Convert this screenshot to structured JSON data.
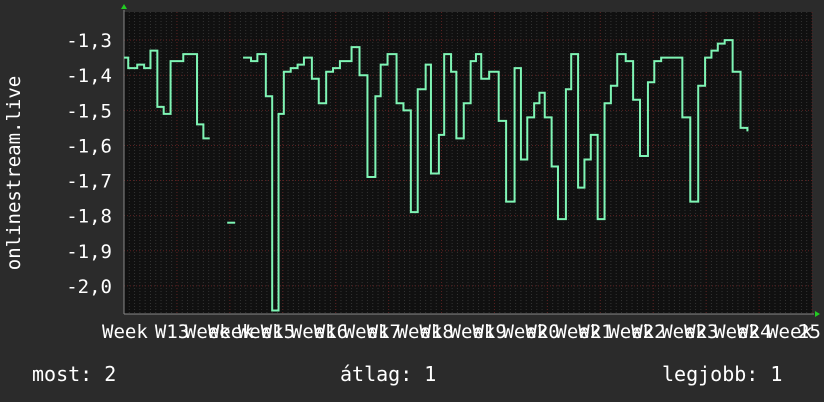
{
  "chart_data": {
    "type": "line",
    "ylabel": "onlinestream.live",
    "xlabel": "",
    "ylim": [
      -2.08,
      -1.22
    ],
    "yticks": [
      -1.3,
      -1.4,
      -1.5,
      -1.6,
      -1.7,
      -1.8,
      -1.9,
      -2.0
    ],
    "ytick_labels": [
      "-1,3",
      "-1,4",
      "-1,5",
      "-1,6",
      "-1,7",
      "-1,8",
      "-1,9",
      "-2,0"
    ],
    "xlim": [
      12,
      25
    ],
    "xticks": [
      12,
      13,
      14,
      15,
      16,
      17,
      18,
      19,
      20,
      21,
      22,
      23,
      24,
      25
    ],
    "xtick_labels": [
      "Week",
      "W13",
      "Week",
      "W15",
      "W16",
      "W17",
      "W18",
      "W19",
      "W20",
      "W21",
      "W22",
      "W23",
      "W24",
      "25"
    ],
    "x_labels_extra": [
      "Week",
      "Week",
      "Week",
      "Week",
      "Week",
      "Week",
      "Week",
      "Week",
      "Week",
      "Week",
      "Week",
      "Week"
    ],
    "grid": true,
    "colors": {
      "line": "#7ff5b5",
      "background": "#101010",
      "grid": "#5a2020",
      "axis": "#888888",
      "arrow": "#22cc22"
    },
    "series": [
      {
        "segments": [
          [
            [
              12.0,
              -1.35
            ],
            [
              12.08,
              -1.38
            ],
            [
              12.25,
              -1.37
            ],
            [
              12.38,
              -1.38
            ],
            [
              12.5,
              -1.33
            ],
            [
              12.63,
              -1.49
            ],
            [
              12.75,
              -1.51
            ],
            [
              12.88,
              -1.36
            ],
            [
              13.12,
              -1.34
            ],
            [
              13.38,
              -1.54
            ],
            [
              13.5,
              -1.58
            ],
            [
              13.62,
              -1.58
            ]
          ],
          [
            [
              13.95,
              -1.82
            ],
            [
              14.1,
              -1.82
            ]
          ],
          [
            [
              14.25,
              -1.35
            ],
            [
              14.4,
              -1.36
            ],
            [
              14.52,
              -1.34
            ],
            [
              14.68,
              -1.46
            ],
            [
              14.8,
              -2.07
            ],
            [
              14.92,
              -1.51
            ],
            [
              15.02,
              -1.39
            ],
            [
              15.15,
              -1.38
            ],
            [
              15.28,
              -1.37
            ],
            [
              15.4,
              -1.35
            ],
            [
              15.55,
              -1.41
            ],
            [
              15.68,
              -1.48
            ],
            [
              15.82,
              -1.39
            ],
            [
              15.95,
              -1.38
            ],
            [
              16.08,
              -1.36
            ],
            [
              16.3,
              -1.32
            ],
            [
              16.45,
              -1.4
            ],
            [
              16.6,
              -1.69
            ],
            [
              16.75,
              -1.46
            ],
            [
              16.85,
              -1.37
            ],
            [
              16.98,
              -1.34
            ],
            [
              17.15,
              -1.48
            ],
            [
              17.28,
              -1.5
            ],
            [
              17.42,
              -1.79
            ],
            [
              17.55,
              -1.44
            ],
            [
              17.7,
              -1.37
            ],
            [
              17.8,
              -1.68
            ],
            [
              17.95,
              -1.57
            ],
            [
              18.05,
              -1.34
            ],
            [
              18.18,
              -1.39
            ],
            [
              18.28,
              -1.58
            ],
            [
              18.42,
              -1.48
            ],
            [
              18.55,
              -1.36
            ],
            [
              18.65,
              -1.34
            ],
            [
              18.75,
              -1.41
            ],
            [
              18.9,
              -1.39
            ],
            [
              19.08,
              -1.53
            ],
            [
              19.22,
              -1.76
            ],
            [
              19.38,
              -1.38
            ],
            [
              19.5,
              -1.64
            ],
            [
              19.62,
              -1.52
            ],
            [
              19.75,
              -1.48
            ],
            [
              19.85,
              -1.45
            ],
            [
              19.95,
              -1.52
            ],
            [
              20.08,
              -1.66
            ],
            [
              20.2,
              -1.81
            ],
            [
              20.35,
              -1.44
            ],
            [
              20.45,
              -1.34
            ],
            [
              20.58,
              -1.72
            ],
            [
              20.7,
              -1.64
            ],
            [
              20.82,
              -1.57
            ],
            [
              20.95,
              -1.81
            ],
            [
              21.08,
              -1.48
            ],
            [
              21.2,
              -1.43
            ],
            [
              21.32,
              -1.34
            ],
            [
              21.48,
              -1.36
            ],
            [
              21.62,
              -1.47
            ],
            [
              21.75,
              -1.63
            ],
            [
              21.9,
              -1.42
            ],
            [
              22.02,
              -1.36
            ],
            [
              22.15,
              -1.35
            ],
            [
              22.28,
              -1.35
            ],
            [
              22.42,
              -1.35
            ],
            [
              22.55,
              -1.52
            ],
            [
              22.7,
              -1.76
            ],
            [
              22.85,
              -1.43
            ],
            [
              22.98,
              -1.35
            ],
            [
              23.1,
              -1.33
            ],
            [
              23.22,
              -1.31
            ],
            [
              23.35,
              -1.3
            ],
            [
              23.5,
              -1.39
            ],
            [
              23.65,
              -1.55
            ],
            [
              23.78,
              -1.56
            ]
          ]
        ]
      }
    ]
  },
  "stats": {
    "current": "most: 2",
    "average": "átlag: 1",
    "best": "legjobb: 1"
  }
}
